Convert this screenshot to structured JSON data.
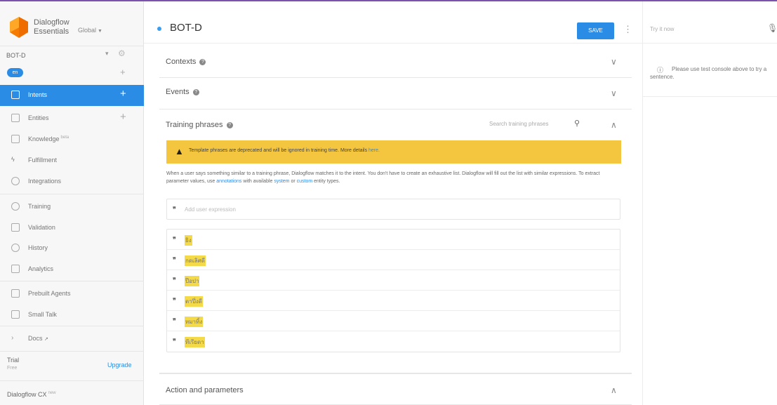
{
  "brand": {
    "line1": "Dialogflow",
    "line2": "Essentials",
    "region": "Global"
  },
  "agent": {
    "name": "BOT-D",
    "language": "en"
  },
  "sidebar": {
    "items": [
      {
        "label": "Intents"
      },
      {
        "label": "Entities"
      },
      {
        "label": "Knowledge",
        "badge": "beta"
      },
      {
        "label": "Fulfillment"
      },
      {
        "label": "Integrations"
      },
      {
        "label": "Training"
      },
      {
        "label": "Validation"
      },
      {
        "label": "History"
      },
      {
        "label": "Analytics"
      },
      {
        "label": "Prebuilt Agents"
      },
      {
        "label": "Small Talk"
      },
      {
        "label": "Docs"
      }
    ],
    "trial": "Trial",
    "trial_sub": "Free",
    "upgrade": "Upgrade",
    "cx": "Dialogflow CX",
    "cx_badge": "new"
  },
  "main": {
    "title": "BOT-D",
    "save": "SAVE",
    "sections": {
      "contexts": "Contexts",
      "events": "Events",
      "training": "Training phrases",
      "action": "Action and parameters"
    },
    "search_placeholder": "Search training phrases",
    "warning": {
      "text": "Template phrases are deprecated and will be ignored in training time. More details ",
      "link": "here."
    },
    "desc": {
      "p1": "When a user says something similar to a training phrase, Dialogflow matches it to the intent. You don't have to create an exhaustive list. Dialogflow will fill out the list with similar expressions. To extract parameter values, use ",
      "l1": "annotations",
      "p2": " with available ",
      "l2": "system",
      "p3": " or ",
      "l3": "custom",
      "p4": " entity types."
    },
    "add_placeholder": "Add user expression",
    "phrases": [
      "ยิง",
      "กดเลิศดี",
      "ป๊อปา",
      "ตาปึ่งดี",
      "หมาทิ้ง",
      "ทีเรียดา"
    ]
  },
  "console": {
    "try": "Try it now",
    "hint": "Please use test console above to try a sentence."
  },
  "colors": {
    "accent": "#2b8ce6",
    "warning": "#f4c53f",
    "highlight": "#f4d948",
    "topline": "#7b52ae"
  }
}
